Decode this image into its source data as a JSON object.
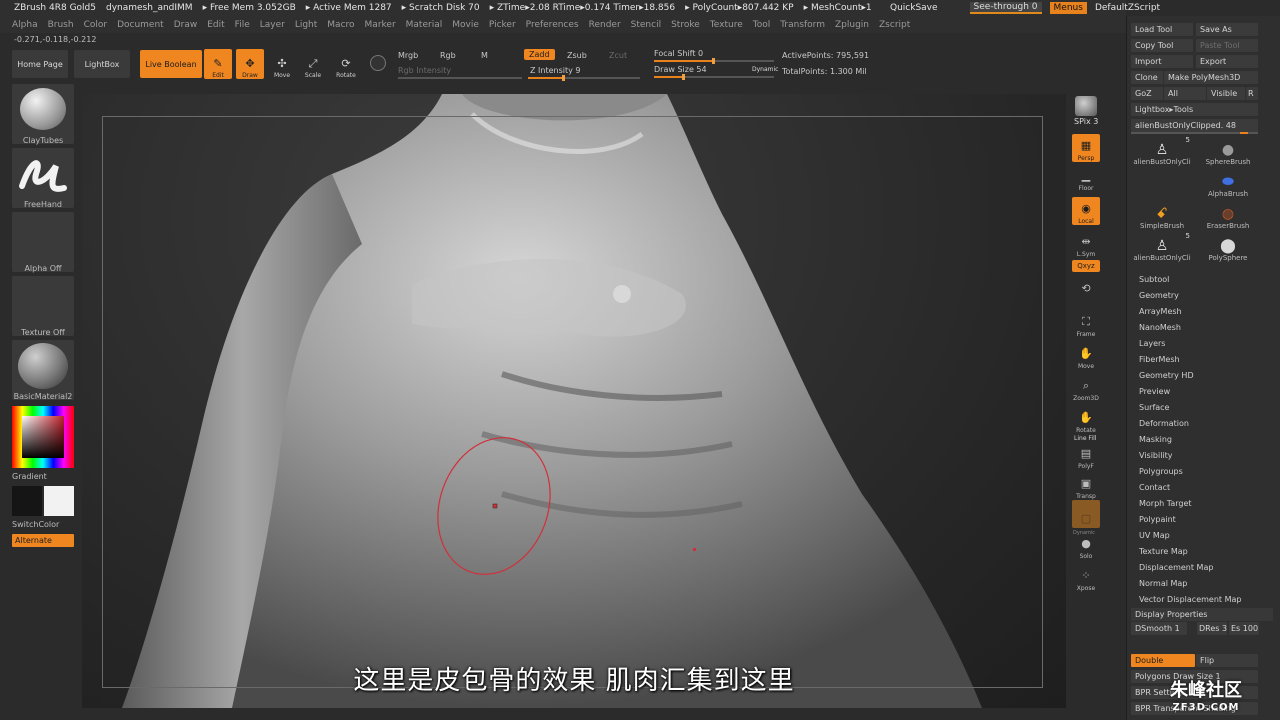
{
  "title_bar": {
    "app": "ZBrush 4R8 Gold5",
    "doc": "dynamesh_andIMM",
    "free_mem": "▸ Free Mem 3.052GB",
    "active_mem": "▸ Active Mem 1287",
    "scratch": "▸ Scratch Disk 70",
    "ztime": "▸ ZTime▸2.08 RTime▸0.174 Timer▸18.856",
    "polycount": "▸ PolyCount▸807.442 KP",
    "meshcount": "▸ MeshCount▸1"
  },
  "quick": {
    "quicksave": "QuickSave",
    "see_through": "See-through 0",
    "menus": "Menus",
    "default_zscript": "DefaultZScript"
  },
  "menus": [
    "Alpha",
    "Brush",
    "Color",
    "Document",
    "Draw",
    "Edit",
    "File",
    "Layer",
    "Light",
    "Macro",
    "Marker",
    "Material",
    "Movie",
    "Picker",
    "Preferences",
    "Render",
    "Stencil",
    "Stroke",
    "Texture",
    "Tool",
    "Transform",
    "Zplugin",
    "Zscript"
  ],
  "coords": "-0.271,-0.118,-0.212",
  "shelf": {
    "home_page": "Home Page",
    "lightbox": "LightBox",
    "live_boolean": "Live Boolean",
    "edit": "Edit",
    "draw": "Draw",
    "move": "Move",
    "scale": "Scale",
    "rotate": "Rotate",
    "mrgb": "Mrgb",
    "rgb": "Rgb",
    "m": "M",
    "rgb_intensity": "Rgb Intensity",
    "zadd": "Zadd",
    "zsub": "Zsub",
    "zcut": "Zcut",
    "z_intensity": "Z Intensity 9",
    "focal_shift": "Focal Shift 0",
    "draw_size": "Draw Size 54",
    "dynamic": "Dynamic",
    "active_points": "ActivePoints: 795,591",
    "total_points": "TotalPoints: 1.300 Mil"
  },
  "left_tray": {
    "brush": "ClayTubes",
    "stroke": "FreeHand",
    "alpha": "Alpha Off",
    "texture": "Texture Off",
    "material": "BasicMaterial2",
    "gradient": "Gradient",
    "switch_color": "SwitchColor",
    "alternate": "Alternate"
  },
  "canvas": {
    "subtitle": "这里是皮包骨的效果 肌肉汇集到这里"
  },
  "right_shelf": {
    "bpr": "BPR",
    "spix": "SPix 3",
    "persp": "Persp",
    "floor": "Floor",
    "local": "Local",
    "lsym": "L.Sym",
    "xyz": "Qxyz",
    "frame": "Frame",
    "move": "Move",
    "zoom3d": "Zoom3D",
    "rotate": "Rotate",
    "line_fill": "Line Fill",
    "polyf": "PolyF",
    "transp": "Transp",
    "dynamic": "Dynamic",
    "solo": "Solo",
    "xpose": "Xpose"
  },
  "palette": {
    "load_tool": "Load Tool",
    "save_as": "Save As",
    "copy_tool": "Copy Tool",
    "paste_tool": "Paste Tool",
    "import": "Import",
    "export": "Export",
    "clone": "Clone",
    "make_polymesh": "Make PolyMesh3D",
    "goz": "GoZ",
    "all": "All",
    "visible": "Visible",
    "r": "R",
    "lightbox_tools": "Lightbox▸Tools",
    "current_tool": "alienBustOnlyClipped. 48",
    "thumbs": [
      {
        "label": "alienBustOnlyCli",
        "count": "5",
        "icon": "figure-icon"
      },
      {
        "label": "SphereBrush",
        "count": "",
        "icon": "sphere-icon"
      },
      {
        "label": "",
        "count": "",
        "icon": ""
      },
      {
        "label": "AlphaBrush",
        "count": "",
        "icon": "alpha-brush-icon"
      },
      {
        "label": "SimpleBrush",
        "count": "",
        "icon": "simple-brush-icon"
      },
      {
        "label": "EraserBrush",
        "count": "",
        "icon": "eraser-icon"
      },
      {
        "label": "alienBustOnlyCli",
        "count": "5",
        "icon": "figure-icon"
      },
      {
        "label": "PolySphere",
        "count": "",
        "icon": "polysphere-icon"
      }
    ],
    "subpalettes": [
      "Subtool",
      "Geometry",
      "ArrayMesh",
      "NanoMesh",
      "Layers",
      "FiberMesh",
      "Geometry HD",
      "Preview",
      "Surface",
      "Deformation",
      "Masking",
      "Visibility",
      "Polygroups",
      "Contact",
      "Morph Target",
      "Polypaint",
      "UV Map",
      "Texture Map",
      "Displacement Map",
      "Normal Map",
      "Vector Displacement Map"
    ],
    "display_properties": "Display Properties",
    "dsmooth": "DSmooth 1",
    "dres": "DRes 3",
    "es": "Es 100",
    "double": "Double",
    "flip": "Flip",
    "polygons_draw_size": "Polygons Draw Size 1",
    "bpr_settings": "BPR Settings",
    "bpr_transparent": "BPR Transparent Shading"
  },
  "watermark": {
    "cn": "朱峰社区",
    "en": "ZF3D.COM"
  }
}
